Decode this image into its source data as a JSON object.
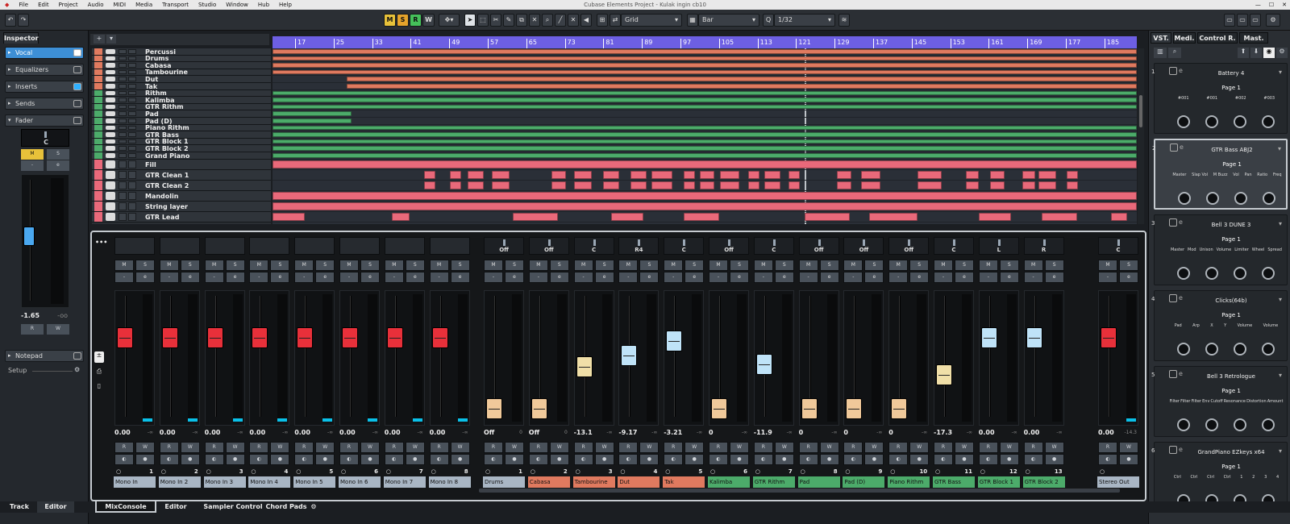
{
  "menu": [
    "File",
    "Edit",
    "Project",
    "Audio",
    "MIDI",
    "Media",
    "Transport",
    "Studio",
    "Window",
    "Hub",
    "Help"
  ],
  "window_title": "Cubase Elements Project - Kulak ingin cb10",
  "toolbar": {
    "m": "M",
    "s": "S",
    "r": "R",
    "w": "W",
    "snap_type": "Grid",
    "quantize_grid": "Bar",
    "quantize_value": "1/32"
  },
  "inspector": {
    "tab": "Inspector",
    "track_name": "Vocal",
    "sections": [
      "Equalizers",
      "Inserts",
      "Sends",
      "Fader",
      "Notepad"
    ],
    "pan": "C",
    "m": "M",
    "s": "S",
    "e": "e",
    "volume": "-1.65",
    "peak": "-oo",
    "r": "R",
    "w": "W",
    "setup": "Setup",
    "bottom_tabs": [
      "Track",
      "Editor"
    ]
  },
  "ruler": [
    "17",
    "25",
    "33",
    "41",
    "49",
    "57",
    "65",
    "73",
    "81",
    "89",
    "97",
    "105",
    "113",
    "121",
    "129",
    "137",
    "145",
    "153",
    "161",
    "169",
    "177",
    "185"
  ],
  "tracks": [
    {
      "n": "1",
      "name": "Percussi",
      "color": "#e07a5f"
    },
    {
      "n": "2",
      "name": "Drums",
      "color": "#e07a5f"
    },
    {
      "n": "3",
      "name": "Cabasa",
      "color": "#e07a5f"
    },
    {
      "n": "4",
      "name": "Tambourine",
      "color": "#e07a5f"
    },
    {
      "n": "5",
      "name": "Dut",
      "color": "#e07a5f"
    },
    {
      "n": "6",
      "name": "Tak",
      "color": "#e07a5f"
    },
    {
      "n": "7",
      "name": "Rithm",
      "color": "#4cab6a"
    },
    {
      "n": "8",
      "name": "Kalimba",
      "color": "#4cab6a"
    },
    {
      "n": "9",
      "name": "GTR Rithm",
      "color": "#4cab6a"
    },
    {
      "n": "10",
      "name": "Pad",
      "color": "#4cab6a"
    },
    {
      "n": "11",
      "name": "Pad (D)",
      "color": "#4cab6a"
    },
    {
      "n": "12",
      "name": "Piano Rithm",
      "color": "#4cab6a"
    },
    {
      "n": "13",
      "name": "GTR Bass",
      "color": "#4cab6a"
    },
    {
      "n": "14",
      "name": "GTR Block 1",
      "color": "#4cab6a"
    },
    {
      "n": "15",
      "name": "GTR Block 2",
      "color": "#4cab6a"
    },
    {
      "n": "16",
      "name": "Grand Piano",
      "color": "#4cab6a"
    },
    {
      "n": "17",
      "name": "Fill",
      "color": "#e9697a"
    },
    {
      "n": "18",
      "name": "GTR Clean 1",
      "color": "#e9697a"
    },
    {
      "n": "19",
      "name": "GTR Clean 2",
      "color": "#e9697a"
    },
    {
      "n": "20",
      "name": "Mandolin",
      "color": "#e9697a"
    },
    {
      "n": "21",
      "name": "String layer",
      "color": "#e9697a"
    },
    {
      "n": "22",
      "name": "GTR Lead",
      "color": "#e9697a"
    }
  ],
  "mixer": {
    "channels": [
      {
        "name": "Mono In",
        "num": "1",
        "vol": "0.00",
        "peak": "-∞",
        "pan": "",
        "fader": 0.7,
        "color": "#a9b6c4",
        "cap": "#e8303a"
      },
      {
        "name": "Mono In 2",
        "num": "2",
        "vol": "0.00",
        "peak": "-∞",
        "pan": "",
        "fader": 0.7,
        "color": "#a9b6c4",
        "cap": "#e8303a"
      },
      {
        "name": "Mono In 3",
        "num": "3",
        "vol": "0.00",
        "peak": "-∞",
        "pan": "",
        "fader": 0.7,
        "color": "#a9b6c4",
        "cap": "#e8303a"
      },
      {
        "name": "Mono In 4",
        "num": "4",
        "vol": "0.00",
        "peak": "-∞",
        "pan": "",
        "fader": 0.7,
        "color": "#a9b6c4",
        "cap": "#e8303a"
      },
      {
        "name": "Mono In 5",
        "num": "5",
        "vol": "0.00",
        "peak": "-∞",
        "pan": "",
        "fader": 0.7,
        "color": "#a9b6c4",
        "cap": "#e8303a"
      },
      {
        "name": "Mono In 6",
        "num": "6",
        "vol": "0.00",
        "peak": "-∞",
        "pan": "",
        "fader": 0.7,
        "color": "#a9b6c4",
        "cap": "#e8303a"
      },
      {
        "name": "Mono In 7",
        "num": "7",
        "vol": "0.00",
        "peak": "-∞",
        "pan": "",
        "fader": 0.7,
        "color": "#a9b6c4",
        "cap": "#e8303a"
      },
      {
        "name": "Mono In 8",
        "num": "8",
        "vol": "0.00",
        "peak": "-∞",
        "pan": "",
        "fader": 0.7,
        "color": "#a9b6c4",
        "cap": "#e8303a"
      },
      {
        "name": "Drums",
        "num": "1",
        "vol": "Off",
        "peak": "0",
        "pan": "Off",
        "fader": 0.02,
        "color": "#a9b6c4",
        "cap": "#f0c99a"
      },
      {
        "name": "Cabasa",
        "num": "2",
        "vol": "Off",
        "peak": "0",
        "pan": "Off",
        "fader": 0.02,
        "color": "#e07a5f",
        "cap": "#f0c99a"
      },
      {
        "name": "Tambourine",
        "num": "3",
        "vol": "-13.1",
        "peak": "-∞",
        "pan": "C",
        "fader": 0.42,
        "color": "#e07a5f",
        "cap": "#f0dfa8"
      },
      {
        "name": "Dut",
        "num": "4",
        "vol": "-9.17",
        "peak": "-∞",
        "pan": "R4",
        "fader": 0.53,
        "color": "#e07a5f",
        "cap": "#bfe3f8"
      },
      {
        "name": "Tak",
        "num": "5",
        "vol": "-3.21",
        "peak": "-∞",
        "pan": "C",
        "fader": 0.67,
        "color": "#e07a5f",
        "cap": "#bfe3f8"
      },
      {
        "name": "Kalimba",
        "num": "6",
        "vol": "0",
        "peak": "-∞",
        "pan": "Off",
        "fader": 0.02,
        "color": "#4cab6a",
        "cap": "#f0c99a"
      },
      {
        "name": "GTR Rithm",
        "num": "7",
        "vol": "-11.9",
        "peak": "-∞",
        "pan": "C",
        "fader": 0.45,
        "color": "#4cab6a",
        "cap": "#bfe3f8"
      },
      {
        "name": "Pad",
        "num": "8",
        "vol": "0",
        "peak": "-∞",
        "pan": "Off",
        "fader": 0.02,
        "color": "#4cab6a",
        "cap": "#f0c99a"
      },
      {
        "name": "Pad (D)",
        "num": "9",
        "vol": "0",
        "peak": "-∞",
        "pan": "Off",
        "fader": 0.02,
        "color": "#4cab6a",
        "cap": "#f0c99a"
      },
      {
        "name": "Piano Rithm",
        "num": "10",
        "vol": "0",
        "peak": "-∞",
        "pan": "Off",
        "fader": 0.02,
        "color": "#4cab6a",
        "cap": "#f0c99a"
      },
      {
        "name": "GTR Bass",
        "num": "11",
        "vol": "-17.3",
        "peak": "-∞",
        "pan": "C",
        "fader": 0.35,
        "color": "#4cab6a",
        "cap": "#f0dfa8"
      },
      {
        "name": "GTR Block 1",
        "num": "12",
        "vol": "0.00",
        "peak": "-∞",
        "pan": "L",
        "fader": 0.7,
        "color": "#4cab6a",
        "cap": "#bfe3f8"
      },
      {
        "name": "GTR Block 2",
        "num": "13",
        "vol": "0.00",
        "peak": "-∞",
        "pan": "R",
        "fader": 0.7,
        "color": "#4cab6a",
        "cap": "#bfe3f8"
      },
      {
        "name": "Stereo Out",
        "num": "",
        "vol": "0.00",
        "peak": "-14.3",
        "pan": "C",
        "fader": 0.7,
        "color": "#a9b6c4",
        "cap": "#e8303a"
      }
    ],
    "m": "M",
    "s": "S",
    "e": "e",
    "r": "R",
    "w": "W"
  },
  "rack": {
    "tabs": [
      "VST.",
      "Medi.",
      "Control R.",
      "Mast."
    ],
    "slots": [
      {
        "n": "1",
        "name": "Battery 4",
        "page": "Page 1",
        "labels": [
          "#001",
          "#001",
          "#002",
          "#003"
        ]
      },
      {
        "n": "2",
        "name": "GTR Bass ABJ2",
        "page": "Page 1",
        "labels": [
          "Master",
          "Slap Vol",
          "M Buzz",
          "Vol",
          "Pan",
          "Ratio",
          "Freq"
        ]
      },
      {
        "n": "3",
        "name": "Bell 3 DUNE 3",
        "page": "Page 1",
        "labels": [
          "Master",
          "Mod",
          "Unison",
          "Volume",
          "Limiter",
          "Wheel",
          "Spread"
        ]
      },
      {
        "n": "4",
        "name": "Clicks(64b)",
        "page": "Page 1",
        "labels": [
          "Pad",
          "Arp",
          "X",
          "Y",
          "Volume",
          "Volume"
        ]
      },
      {
        "n": "5",
        "name": "Bell 3 Retrologue",
        "page": "Page 1",
        "labels": [
          "Filter",
          "Filter",
          "Filter",
          "Env",
          "Cutoff",
          "Resonance",
          "Distortion",
          "Amount"
        ]
      },
      {
        "n": "6",
        "name": "GrandPiano EZkeys x64",
        "page": "Page 1",
        "labels": [
          "Ctrl",
          "Ctrl",
          "Ctrl",
          "Ctrl",
          "1",
          "2",
          "3",
          "4"
        ]
      }
    ]
  },
  "bottom_tabs": [
    "MixConsole",
    "Editor",
    "Sampler Control",
    "Chord Pads"
  ]
}
